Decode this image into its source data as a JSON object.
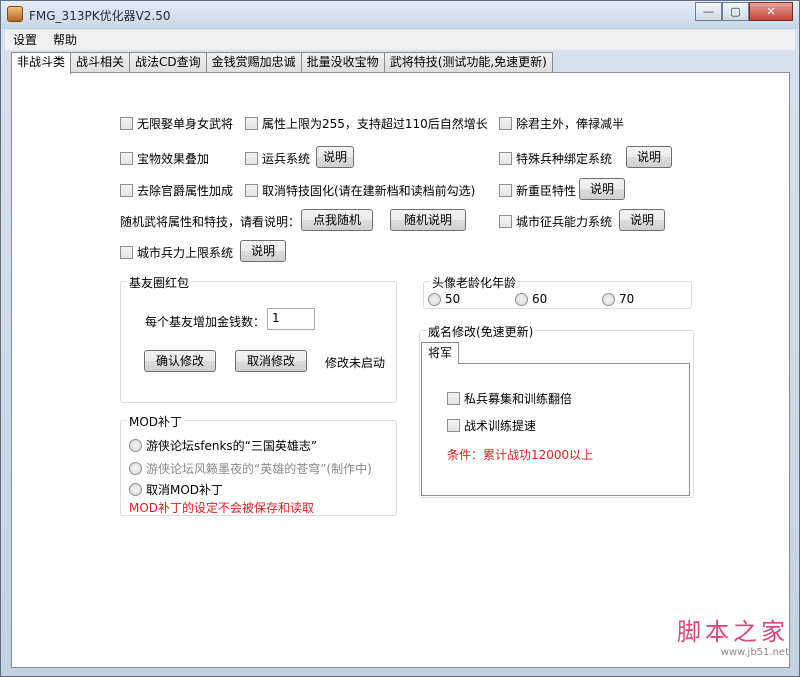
{
  "window": {
    "title": "FMG_313PK优化器V2.50",
    "controls": {
      "minimize": "—",
      "maximize": "▢",
      "close": "✕"
    }
  },
  "menu": [
    "设置",
    "帮助"
  ],
  "tabs": [
    "非战斗类",
    "战斗相关",
    "战法CD查询",
    "金钱赏赐加忠诚",
    "批量没收宝物",
    "武将特技(测试功能,免速更新)"
  ],
  "options": {
    "unlimited_female": "无限娶单身女武将",
    "attr_limit": "属性上限为255，支持超过110后自然增长",
    "except_lord": "除君主外，俸禄减半",
    "treasure_stack": "宝物效果叠加",
    "transport": "运兵系统",
    "special_troop": "特殊兵种绑定系统",
    "remove_rank": "去除官爵属性加成",
    "cancel_skill_fix": "取消特技固化(请在建新档和读档前勾选)",
    "new_officer": "新重臣特性",
    "random_hint": "随机武将属性和特技，请看说明：",
    "city_recruit": "城市征兵能力系统",
    "city_troop_limit": "城市兵力上限系统"
  },
  "buttons": {
    "explain": "说明",
    "random_me": "点我随机",
    "random_explain": "随机说明",
    "confirm": "确认修改",
    "cancel": "取消修改"
  },
  "friend_circle": {
    "title": "基友圈红包",
    "label": "每个基友增加金钱数：",
    "value": "1",
    "status": "修改未启动"
  },
  "avatar_age": {
    "title": "头像老龄化年龄",
    "options": [
      "50",
      "60",
      "70"
    ]
  },
  "prestige": {
    "title": "威名修改(免速更新)",
    "tab": "将军",
    "opt1": "私兵募集和训练翻倍",
    "opt2": "战术训练提速",
    "condition": "条件：累计战功12000以上"
  },
  "mod": {
    "title": "MOD补丁",
    "opt1": "游侠论坛sfenks的“三国英雄志”",
    "opt2": "游侠论坛风籁墨夜的“英雄的苍穹”(制作中)",
    "opt3": "取消MOD补丁",
    "note": "MOD补丁的设定不会被保存和读取"
  },
  "watermark": {
    "name": "脚本之家",
    "url": "www.jb51.net"
  }
}
